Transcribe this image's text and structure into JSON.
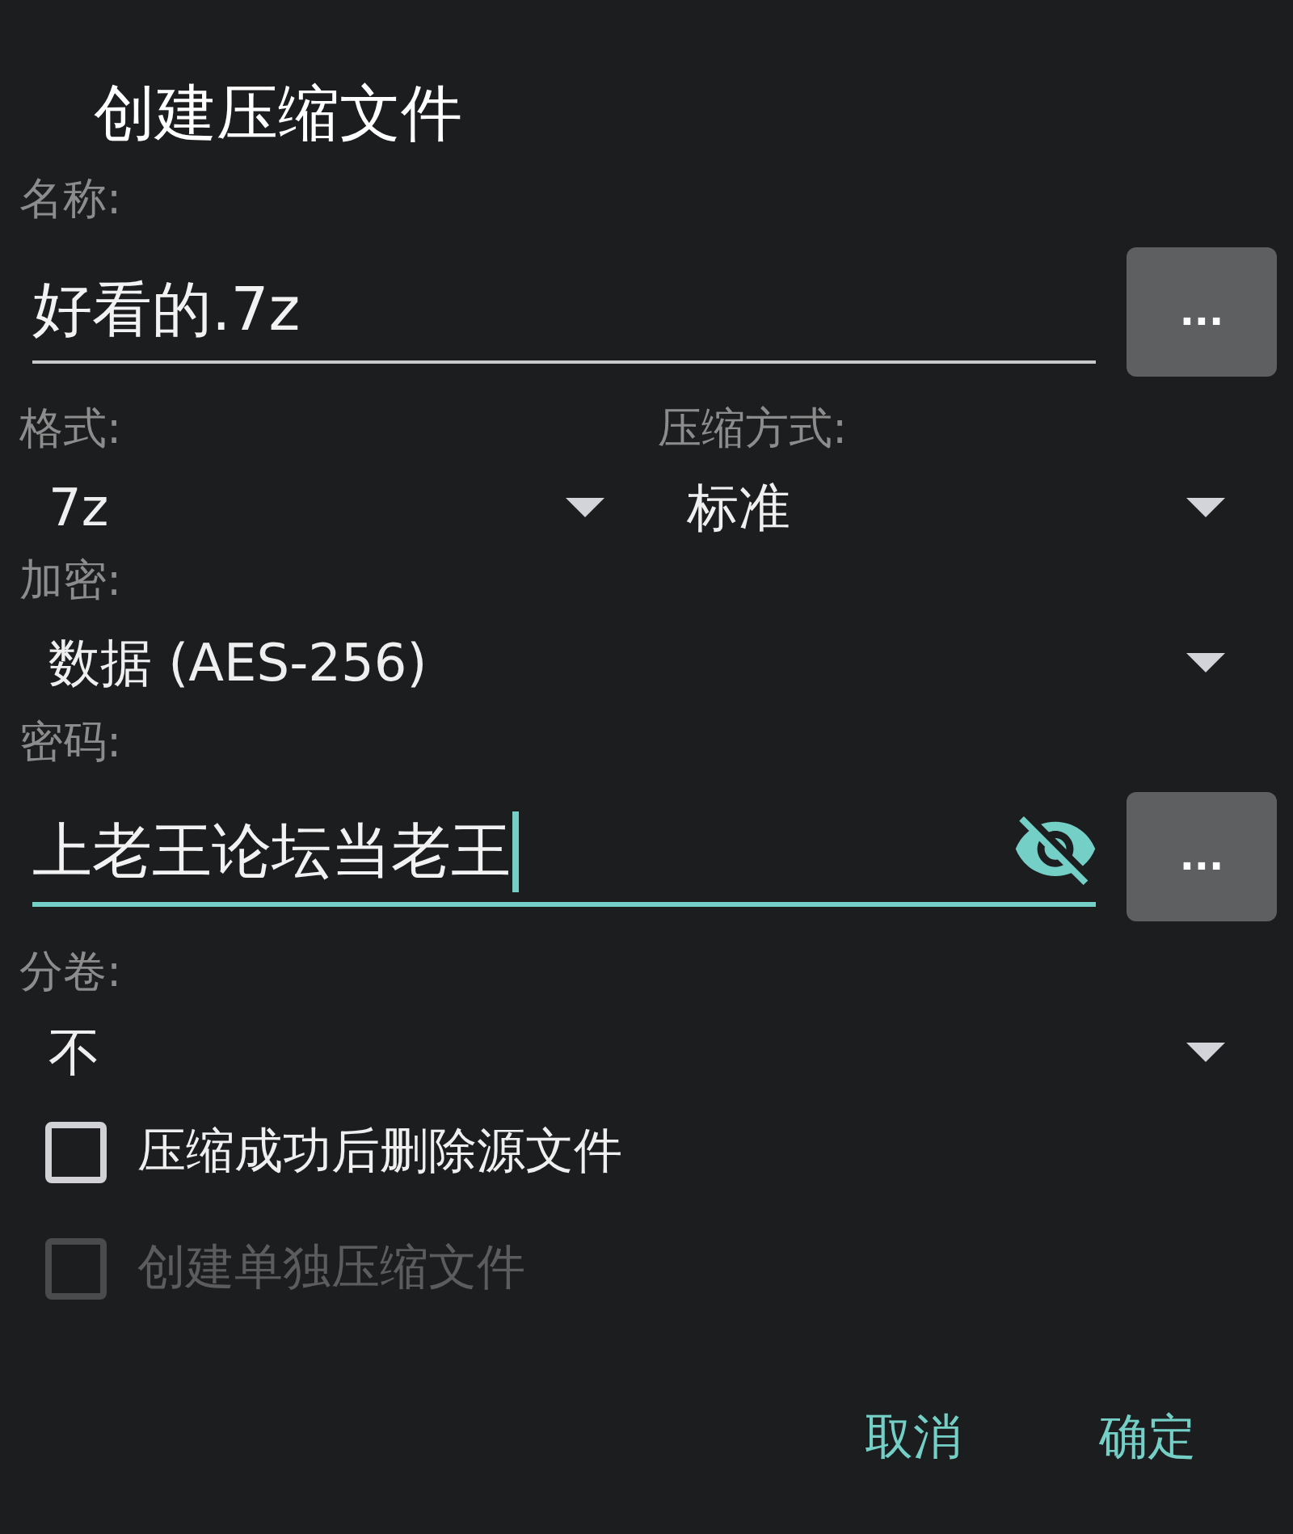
{
  "dialog": {
    "title": "创建压缩文件"
  },
  "name": {
    "label": "名称:",
    "value": "好看的.7z",
    "focused": false,
    "browse_button": "..."
  },
  "format": {
    "label": "格式:",
    "value": "7z"
  },
  "compression": {
    "label": "压缩方式:",
    "value": "标准"
  },
  "encryption": {
    "label": "加密:",
    "value": "数据 (AES-256)"
  },
  "password": {
    "label": "密码:",
    "value": "上老王论坛当老王",
    "focused": true,
    "browse_button": "..."
  },
  "volumes": {
    "label": "分卷:",
    "value": "不"
  },
  "options": [
    {
      "label": "压缩成功后删除源文件",
      "checked": false,
      "disabled": false
    },
    {
      "label": "创建单独压缩文件",
      "checked": false,
      "disabled": true
    }
  ],
  "buttons": [
    "取消",
    "确定"
  ]
}
